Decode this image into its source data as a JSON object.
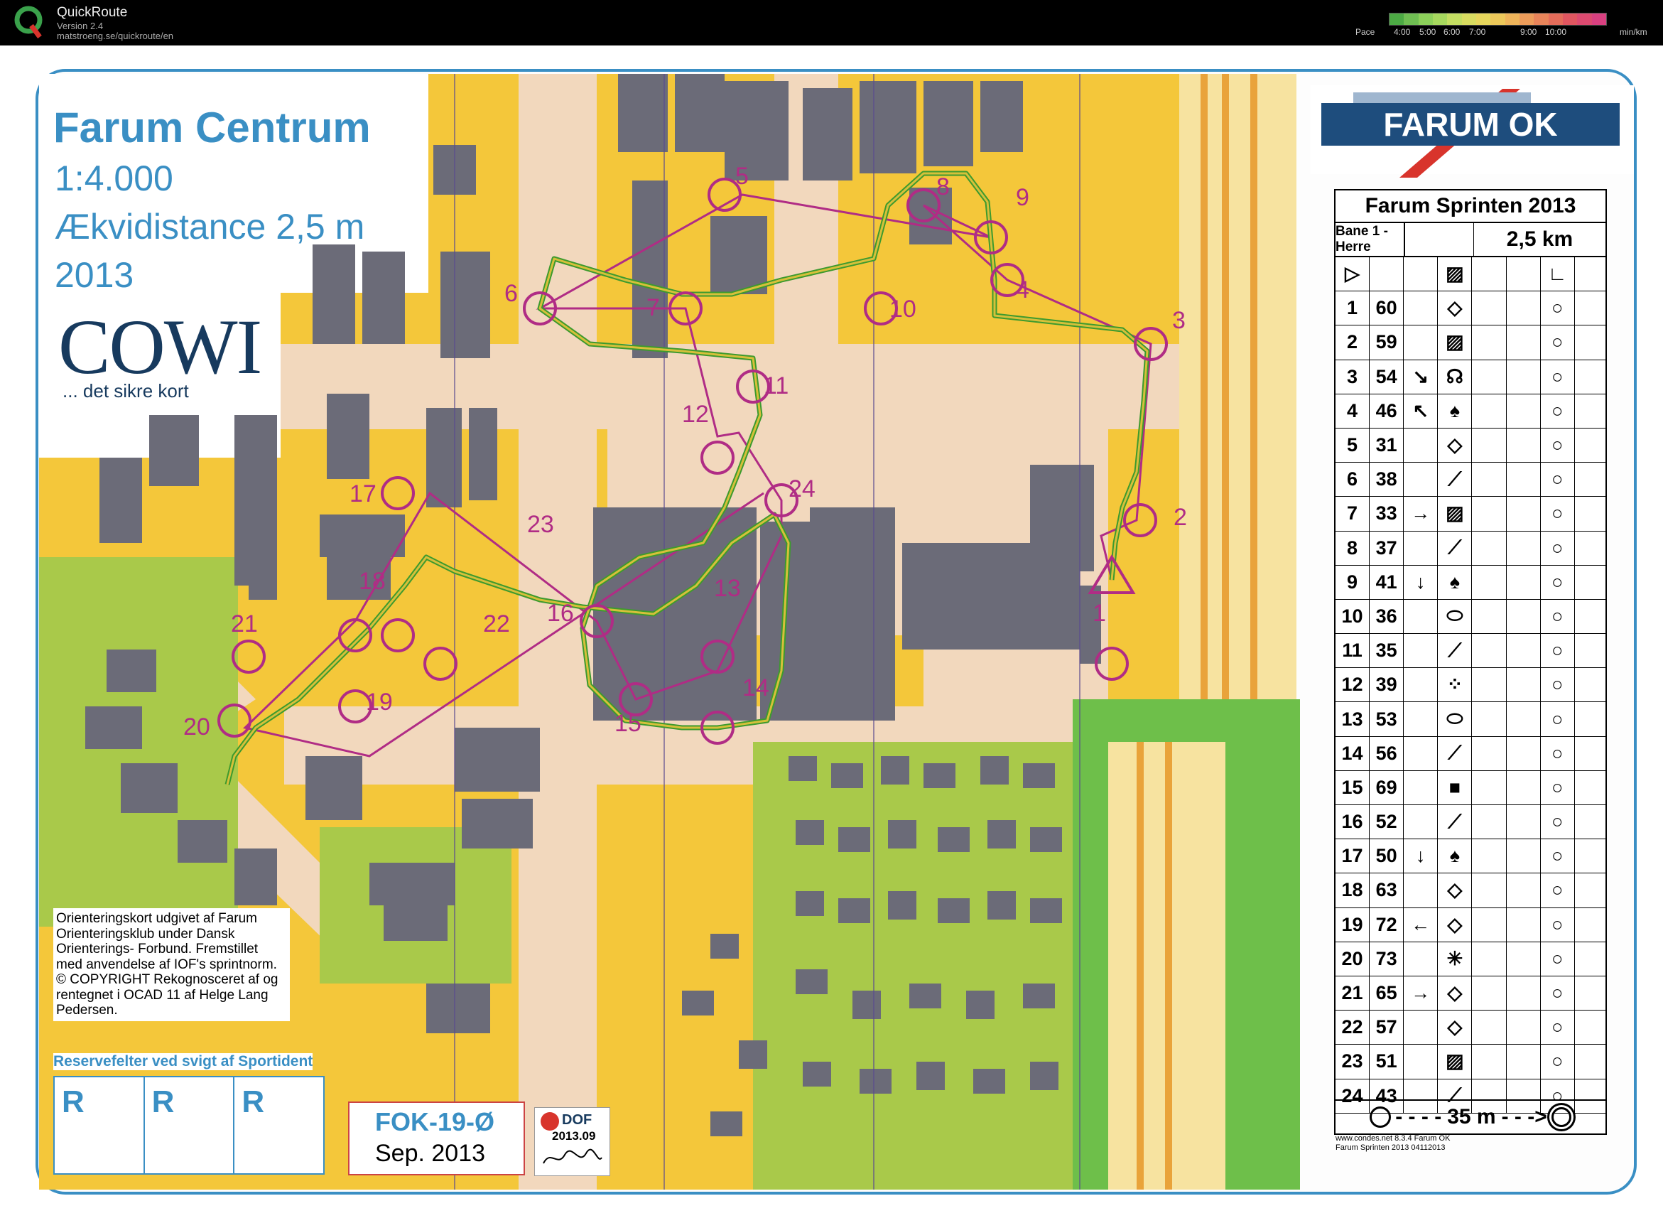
{
  "app": {
    "name": "QuickRoute",
    "version": "Version 2.4",
    "url": "matstroeng.se/quickroute/en"
  },
  "pace_legend": {
    "label": "Pace",
    "unit": "min/km",
    "ticks": [
      "4:00",
      "5:00",
      "6:00",
      "7:00",
      "9:00",
      "10:00"
    ],
    "colors": [
      "#4caa44",
      "#6fbe52",
      "#8cd05a",
      "#a6d85e",
      "#c4de62",
      "#d8dc60",
      "#e6d65c",
      "#ecc85a",
      "#eeb45a",
      "#ec9c5a",
      "#e8845a",
      "#e46c5a",
      "#e05660",
      "#dc4a70",
      "#d84080"
    ]
  },
  "map": {
    "title": "Farum Centrum",
    "scale": "1:4.000",
    "contour": "Ækvidistance 2,5 m",
    "year": "2013",
    "sponsor_logo": "COWI",
    "sponsor_slogan": "... det sikre kort",
    "credits": "Orienteringskort udgivet af Farum Orienteringsklub under Dansk Orienterings- Forbund. Fremstillet med anvendelse af IOF's sprintnorm. © COPYRIGHT Rekognosceret af og rentegnet i OCAD 11 af Helge Lang Pedersen.",
    "reserve_title": "Reservefelter ved svigt af Sportident",
    "reserve_cells": [
      "R",
      "R",
      "R"
    ],
    "map_id": "FOK-19-Ø",
    "map_date": "Sep. 2013",
    "dof_text": "DOF",
    "dof_date": "2013.09",
    "club_banner": "FARUM OK",
    "colors": {
      "title_blue": "#3a8fc4",
      "course_magenta": "#b02c85",
      "route_green": "#3d9a2e",
      "open_yellow": "#f4c73a",
      "rough_yellow": "#f7e3a0",
      "paved": "#f2d8bd",
      "building": "#6b6b78",
      "forest_green": "#a9c94a",
      "green_field": "#6ebf4a"
    },
    "control_labels": [
      "1",
      "2",
      "3",
      "4",
      "5",
      "6",
      "7",
      "8",
      "9",
      "10",
      "11",
      "12",
      "13",
      "14",
      "15",
      "16",
      "17",
      "18",
      "19",
      "20",
      "21",
      "22",
      "23",
      "24"
    ]
  },
  "control_descriptions": {
    "event": "Farum Sprinten 2013",
    "course": "Bane 1 - Herre",
    "length": "2,5 km",
    "rows": [
      {
        "n": "1",
        "code": "60"
      },
      {
        "n": "2",
        "code": "59"
      },
      {
        "n": "3",
        "code": "54"
      },
      {
        "n": "4",
        "code": "46"
      },
      {
        "n": "5",
        "code": "31"
      },
      {
        "n": "6",
        "code": "38"
      },
      {
        "n": "7",
        "code": "33"
      },
      {
        "n": "8",
        "code": "37"
      },
      {
        "n": "9",
        "code": "41"
      },
      {
        "n": "10",
        "code": "36"
      },
      {
        "n": "11",
        "code": "35"
      },
      {
        "n": "12",
        "code": "39"
      },
      {
        "n": "13",
        "code": "53"
      },
      {
        "n": "14",
        "code": "56"
      },
      {
        "n": "15",
        "code": "69"
      },
      {
        "n": "16",
        "code": "52"
      },
      {
        "n": "17",
        "code": "50"
      },
      {
        "n": "18",
        "code": "63"
      },
      {
        "n": "19",
        "code": "72"
      },
      {
        "n": "20",
        "code": "73"
      },
      {
        "n": "21",
        "code": "65"
      },
      {
        "n": "22",
        "code": "57"
      },
      {
        "n": "23",
        "code": "51"
      },
      {
        "n": "24",
        "code": "43"
      }
    ],
    "finish_distance": "35 m",
    "footer_line1": "www.condes.net 8.3.4 Farum OK",
    "footer_line2": "Farum Sprinten 2013 04112013"
  }
}
